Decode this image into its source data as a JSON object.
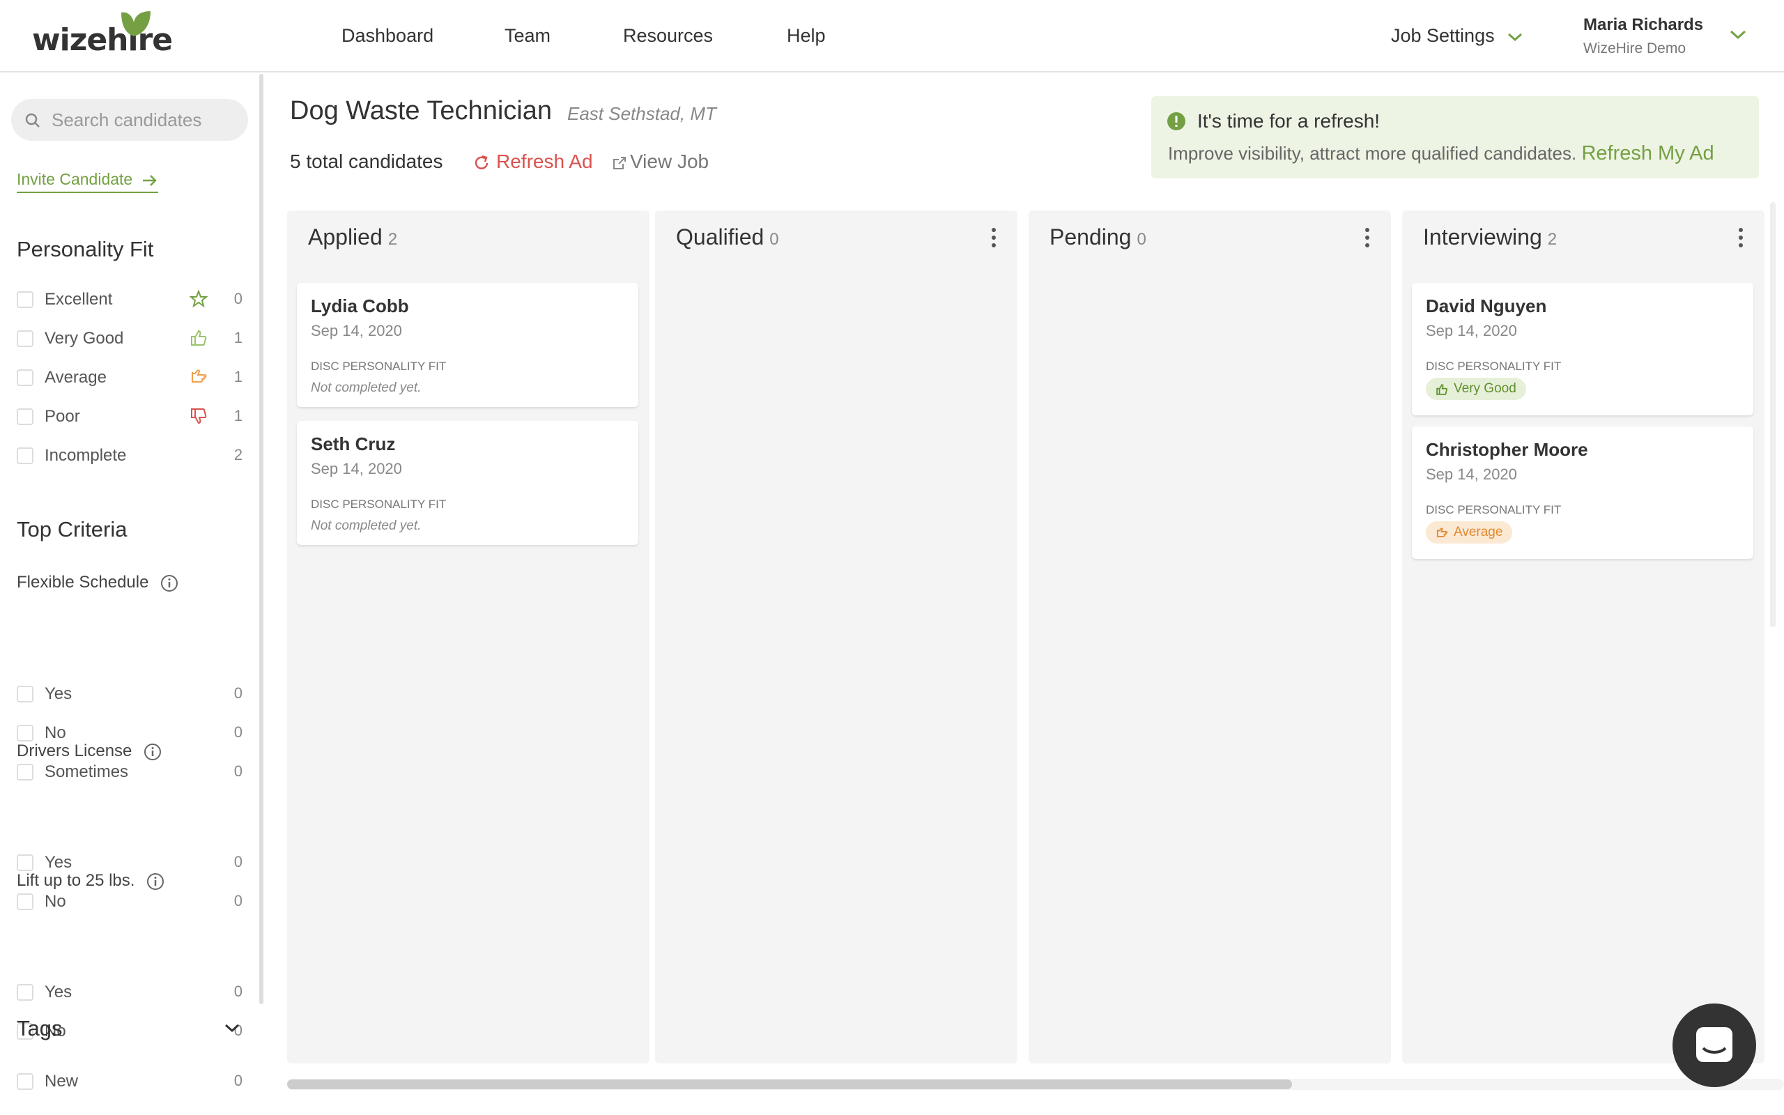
{
  "header": {
    "logo_text": "wizehire",
    "nav": [
      "Dashboard",
      "Team",
      "Resources",
      "Help"
    ],
    "job_settings": "Job Settings",
    "user": {
      "name": "Maria Richards",
      "org": "WizeHire Demo"
    }
  },
  "colors": {
    "accent_green": "#74a043",
    "refresh_red": "#d9534f",
    "badge_good": "#5e8f2c",
    "badge_avg": "#e0892f"
  },
  "sidebar": {
    "search_placeholder": "Search candidates",
    "invite": "Invite Candidate",
    "personality_title": "Personality Fit",
    "personality": [
      {
        "label": "Excellent",
        "count": "0",
        "icon": "star-icon"
      },
      {
        "label": "Very Good",
        "count": "1",
        "icon": "thumbs-up-icon"
      },
      {
        "label": "Average",
        "count": "1",
        "icon": "thumb-sideways-icon"
      },
      {
        "label": "Poor",
        "count": "1",
        "icon": "thumbs-down-icon"
      },
      {
        "label": "Incomplete",
        "count": "2"
      }
    ],
    "criteria_title": "Top Criteria",
    "criteria": [
      {
        "title": "Flexible Schedule",
        "options": [
          {
            "label": "Yes",
            "count": "0"
          },
          {
            "label": "No",
            "count": "0"
          },
          {
            "label": "Sometimes",
            "count": "0"
          }
        ]
      },
      {
        "title": "Drivers License",
        "options": [
          {
            "label": "Yes",
            "count": "0"
          },
          {
            "label": "No",
            "count": "0"
          }
        ]
      },
      {
        "title": "Lift up to 25 lbs.",
        "options": [
          {
            "label": "Yes",
            "count": "0"
          },
          {
            "label": "No",
            "count": "0"
          }
        ]
      }
    ],
    "tags_title": "Tags",
    "tags": [
      {
        "label": "New",
        "count": "0"
      }
    ]
  },
  "job": {
    "title": "Dog Waste Technician",
    "location": "East Sethstad, MT",
    "total": "5 total candidates",
    "refresh": "Refresh Ad",
    "view": "View Job"
  },
  "alert": {
    "title": "It's time for a refresh!",
    "message": "Improve visibility, attract more qualified candidates.",
    "link": "Refresh My Ad"
  },
  "columns": [
    {
      "name": "Applied",
      "count": "2",
      "cards": [
        {
          "name": "Lydia Cobb",
          "date": "Sep 14, 2020",
          "disc_label": "DISC PERSONALITY FIT",
          "disc": "Not completed yet."
        },
        {
          "name": "Seth Cruz",
          "date": "Sep 14, 2020",
          "disc_label": "DISC PERSONALITY FIT",
          "disc": "Not completed yet."
        }
      ]
    },
    {
      "name": "Qualified",
      "count": "0",
      "cards": []
    },
    {
      "name": "Pending",
      "count": "0",
      "cards": []
    },
    {
      "name": "Interviewing",
      "count": "2",
      "cards": [
        {
          "name": "David Nguyen",
          "date": "Sep 14, 2020",
          "disc_label": "DISC PERSONALITY FIT",
          "badge": "Very Good"
        },
        {
          "name": "Christopher Moore",
          "date": "Sep 14, 2020",
          "disc_label": "DISC PERSONALITY FIT",
          "badge": "Average"
        }
      ]
    }
  ]
}
